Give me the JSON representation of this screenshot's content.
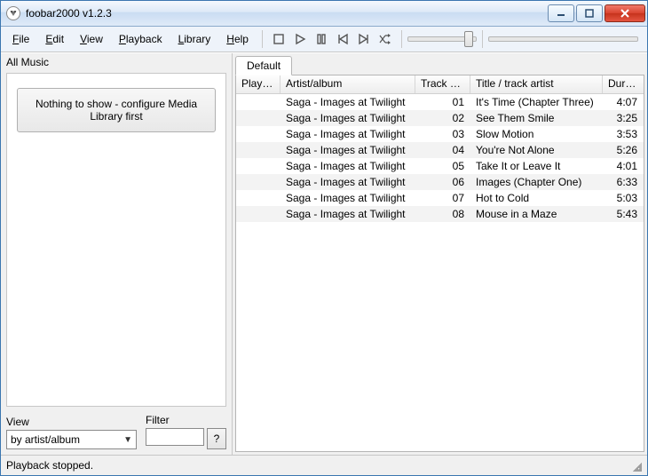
{
  "window": {
    "title": "foobar2000 v1.2.3"
  },
  "menu": {
    "file": "File",
    "edit": "Edit",
    "view": "View",
    "playback": "Playback",
    "library": "Library",
    "help": "Help"
  },
  "sidebar": {
    "header": "All Music",
    "message": "Nothing to show - configure Media Library first",
    "view_label": "View",
    "view_value": "by artist/album",
    "filter_label": "Filter",
    "filter_value": "",
    "help_button": "?"
  },
  "tabs": {
    "default": "Default"
  },
  "playlist": {
    "columns": {
      "playing": "Playing",
      "artist": "Artist/album",
      "trackno": "Track no",
      "title": "Title / track artist",
      "duration": "Dura..."
    },
    "rows": [
      {
        "artist": "Saga - Images at Twilight",
        "trackno": "01",
        "title": "It's Time (Chapter Three)",
        "duration": "4:07"
      },
      {
        "artist": "Saga - Images at Twilight",
        "trackno": "02",
        "title": "See Them Smile",
        "duration": "3:25"
      },
      {
        "artist": "Saga - Images at Twilight",
        "trackno": "03",
        "title": "Slow Motion",
        "duration": "3:53"
      },
      {
        "artist": "Saga - Images at Twilight",
        "trackno": "04",
        "title": "You're Not Alone",
        "duration": "5:26"
      },
      {
        "artist": "Saga - Images at Twilight",
        "trackno": "05",
        "title": "Take It or Leave It",
        "duration": "4:01"
      },
      {
        "artist": "Saga - Images at Twilight",
        "trackno": "06",
        "title": "Images (Chapter One)",
        "duration": "6:33"
      },
      {
        "artist": "Saga - Images at Twilight",
        "trackno": "07",
        "title": "Hot to Cold",
        "duration": "5:03"
      },
      {
        "artist": "Saga - Images at Twilight",
        "trackno": "08",
        "title": "Mouse in a Maze",
        "duration": "5:43"
      }
    ]
  },
  "status": {
    "text": "Playback stopped."
  }
}
